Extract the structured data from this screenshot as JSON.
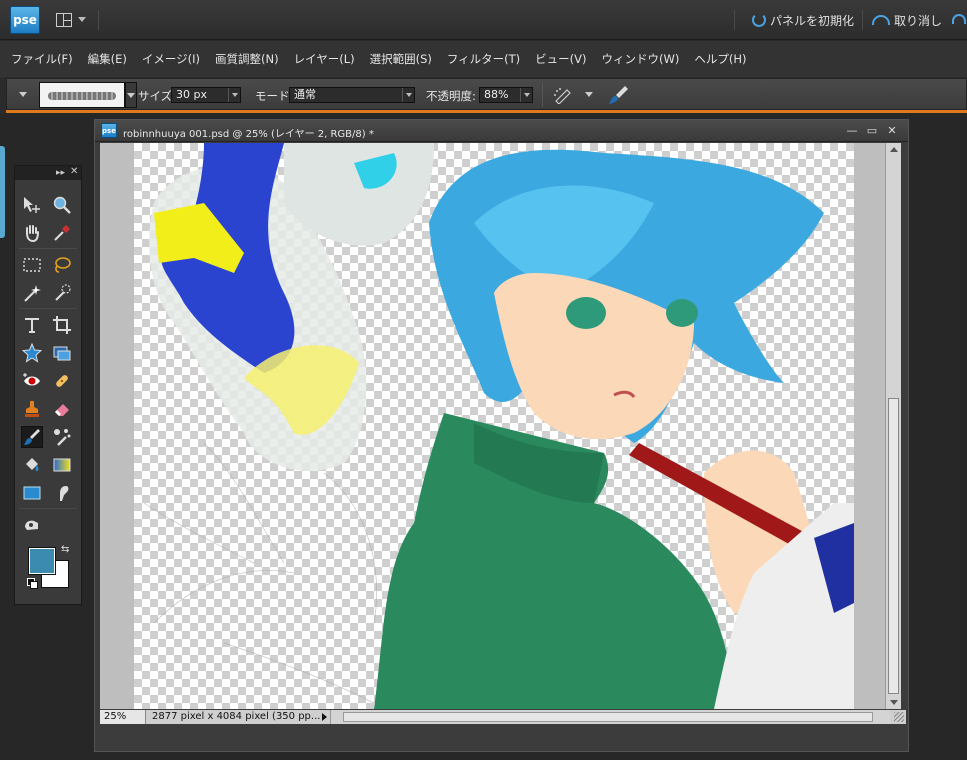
{
  "app": {
    "logo_text": "pse"
  },
  "topbar": {
    "reset_panels_label": "パネルを初期化",
    "undo_label": "取り消し"
  },
  "menu": {
    "items": [
      "ファイル(F)",
      "編集(E)",
      "イメージ(I)",
      "画質調整(N)",
      "レイヤー(L)",
      "選択範囲(S)",
      "フィルター(T)",
      "ビュー(V)",
      "ウィンドウ(W)",
      "ヘルプ(H)"
    ]
  },
  "options": {
    "size_label": "サイズ:",
    "size_value": "30 px",
    "mode_label": "モード:",
    "mode_value": "通常",
    "opacity_label": "不透明度:",
    "opacity_value": "88%"
  },
  "document": {
    "logo_text": "pse",
    "title": "robinnhuuya 001.psd @ 25% (レイヤー 2, RGB/8) *",
    "zoom": "25%",
    "info": "2877 pixel x 4084 pixel (350 pp..."
  },
  "colors": {
    "foreground": "#3b8bb0",
    "background": "#ffffff",
    "accent": "#e07a1e"
  },
  "tools": [
    "move-tool",
    "zoom-tool",
    "hand-tool",
    "eyedropper-tool",
    "marquee-tool",
    "lasso-tool",
    "magic-wand-tool",
    "quick-selection-tool",
    "type-tool",
    "crop-tool",
    "cookie-cutter-tool",
    "recompose-tool",
    "red-eye-tool",
    "healing-tool",
    "clone-stamp-tool",
    "eraser-tool",
    "brush-tool",
    "smart-brush-tool",
    "paint-bucket-tool",
    "gradient-tool",
    "shape-tool",
    "smudge-tool",
    "content-aware-move-tool"
  ]
}
